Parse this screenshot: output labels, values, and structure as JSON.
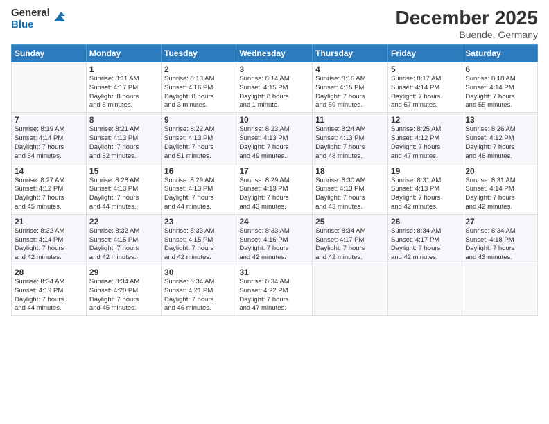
{
  "header": {
    "logo_general": "General",
    "logo_blue": "Blue",
    "title": "December 2025",
    "location": "Buende, Germany"
  },
  "days_of_week": [
    "Sunday",
    "Monday",
    "Tuesday",
    "Wednesday",
    "Thursday",
    "Friday",
    "Saturday"
  ],
  "weeks": [
    [
      {
        "day": "",
        "detail": ""
      },
      {
        "day": "1",
        "detail": "Sunrise: 8:11 AM\nSunset: 4:17 PM\nDaylight: 8 hours\nand 5 minutes."
      },
      {
        "day": "2",
        "detail": "Sunrise: 8:13 AM\nSunset: 4:16 PM\nDaylight: 8 hours\nand 3 minutes."
      },
      {
        "day": "3",
        "detail": "Sunrise: 8:14 AM\nSunset: 4:15 PM\nDaylight: 8 hours\nand 1 minute."
      },
      {
        "day": "4",
        "detail": "Sunrise: 8:16 AM\nSunset: 4:15 PM\nDaylight: 7 hours\nand 59 minutes."
      },
      {
        "day": "5",
        "detail": "Sunrise: 8:17 AM\nSunset: 4:14 PM\nDaylight: 7 hours\nand 57 minutes."
      },
      {
        "day": "6",
        "detail": "Sunrise: 8:18 AM\nSunset: 4:14 PM\nDaylight: 7 hours\nand 55 minutes."
      }
    ],
    [
      {
        "day": "7",
        "detail": "Sunrise: 8:19 AM\nSunset: 4:14 PM\nDaylight: 7 hours\nand 54 minutes."
      },
      {
        "day": "8",
        "detail": "Sunrise: 8:21 AM\nSunset: 4:13 PM\nDaylight: 7 hours\nand 52 minutes."
      },
      {
        "day": "9",
        "detail": "Sunrise: 8:22 AM\nSunset: 4:13 PM\nDaylight: 7 hours\nand 51 minutes."
      },
      {
        "day": "10",
        "detail": "Sunrise: 8:23 AM\nSunset: 4:13 PM\nDaylight: 7 hours\nand 49 minutes."
      },
      {
        "day": "11",
        "detail": "Sunrise: 8:24 AM\nSunset: 4:13 PM\nDaylight: 7 hours\nand 48 minutes."
      },
      {
        "day": "12",
        "detail": "Sunrise: 8:25 AM\nSunset: 4:12 PM\nDaylight: 7 hours\nand 47 minutes."
      },
      {
        "day": "13",
        "detail": "Sunrise: 8:26 AM\nSunset: 4:12 PM\nDaylight: 7 hours\nand 46 minutes."
      }
    ],
    [
      {
        "day": "14",
        "detail": "Sunrise: 8:27 AM\nSunset: 4:12 PM\nDaylight: 7 hours\nand 45 minutes."
      },
      {
        "day": "15",
        "detail": "Sunrise: 8:28 AM\nSunset: 4:13 PM\nDaylight: 7 hours\nand 44 minutes."
      },
      {
        "day": "16",
        "detail": "Sunrise: 8:29 AM\nSunset: 4:13 PM\nDaylight: 7 hours\nand 44 minutes."
      },
      {
        "day": "17",
        "detail": "Sunrise: 8:29 AM\nSunset: 4:13 PM\nDaylight: 7 hours\nand 43 minutes."
      },
      {
        "day": "18",
        "detail": "Sunrise: 8:30 AM\nSunset: 4:13 PM\nDaylight: 7 hours\nand 43 minutes."
      },
      {
        "day": "19",
        "detail": "Sunrise: 8:31 AM\nSunset: 4:13 PM\nDaylight: 7 hours\nand 42 minutes."
      },
      {
        "day": "20",
        "detail": "Sunrise: 8:31 AM\nSunset: 4:14 PM\nDaylight: 7 hours\nand 42 minutes."
      }
    ],
    [
      {
        "day": "21",
        "detail": "Sunrise: 8:32 AM\nSunset: 4:14 PM\nDaylight: 7 hours\nand 42 minutes."
      },
      {
        "day": "22",
        "detail": "Sunrise: 8:32 AM\nSunset: 4:15 PM\nDaylight: 7 hours\nand 42 minutes."
      },
      {
        "day": "23",
        "detail": "Sunrise: 8:33 AM\nSunset: 4:15 PM\nDaylight: 7 hours\nand 42 minutes."
      },
      {
        "day": "24",
        "detail": "Sunrise: 8:33 AM\nSunset: 4:16 PM\nDaylight: 7 hours\nand 42 minutes."
      },
      {
        "day": "25",
        "detail": "Sunrise: 8:34 AM\nSunset: 4:17 PM\nDaylight: 7 hours\nand 42 minutes."
      },
      {
        "day": "26",
        "detail": "Sunrise: 8:34 AM\nSunset: 4:17 PM\nDaylight: 7 hours\nand 42 minutes."
      },
      {
        "day": "27",
        "detail": "Sunrise: 8:34 AM\nSunset: 4:18 PM\nDaylight: 7 hours\nand 43 minutes."
      }
    ],
    [
      {
        "day": "28",
        "detail": "Sunrise: 8:34 AM\nSunset: 4:19 PM\nDaylight: 7 hours\nand 44 minutes."
      },
      {
        "day": "29",
        "detail": "Sunrise: 8:34 AM\nSunset: 4:20 PM\nDaylight: 7 hours\nand 45 minutes."
      },
      {
        "day": "30",
        "detail": "Sunrise: 8:34 AM\nSunset: 4:21 PM\nDaylight: 7 hours\nand 46 minutes."
      },
      {
        "day": "31",
        "detail": "Sunrise: 8:34 AM\nSunset: 4:22 PM\nDaylight: 7 hours\nand 47 minutes."
      },
      {
        "day": "",
        "detail": ""
      },
      {
        "day": "",
        "detail": ""
      },
      {
        "day": "",
        "detail": ""
      }
    ]
  ]
}
